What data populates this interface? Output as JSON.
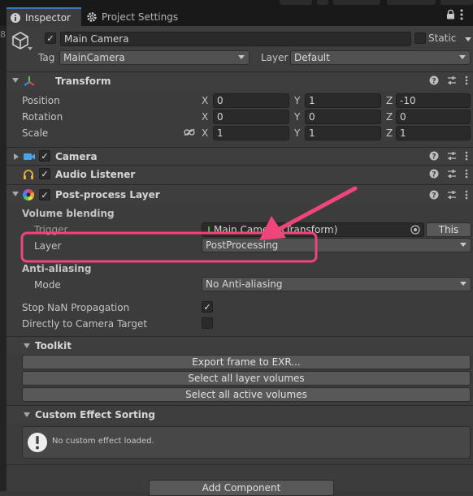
{
  "tabs": {
    "inspector": "Inspector",
    "project_settings": "Project Settings"
  },
  "gameobject": {
    "active": true,
    "name": "Main Camera",
    "static_label": "Static",
    "tag_label": "Tag",
    "tag_value": "MainCamera",
    "layer_label": "Layer",
    "layer_value": "Default"
  },
  "transform": {
    "title": "Transform",
    "position": {
      "label": "Position",
      "x": "0",
      "y": "1",
      "z": "-10"
    },
    "rotation": {
      "label": "Rotation",
      "x": "0",
      "y": "0",
      "z": "0"
    },
    "scale": {
      "label": "Scale",
      "x": "1",
      "y": "1",
      "z": "1"
    },
    "axis": {
      "x": "X",
      "y": "Y",
      "z": "Z"
    }
  },
  "components": {
    "camera": "Camera",
    "audio_listener": "Audio Listener",
    "post_process_layer": "Post-process Layer"
  },
  "volume_blending": {
    "section": "Volume blending",
    "trigger_label": "Trigger",
    "trigger_value": "Main Camera (Transform)",
    "this_button": "This",
    "layer_label": "Layer",
    "layer_value": "PostProcessing"
  },
  "anti_aliasing": {
    "section": "Anti-aliasing",
    "mode_label": "Mode",
    "mode_value": "No Anti-aliasing"
  },
  "options": {
    "stop_nan": "Stop NaN Propagation",
    "stop_nan_checked": true,
    "direct_to_target": "Directly to Camera Target",
    "direct_to_target_checked": false
  },
  "toolkit": {
    "title": "Toolkit",
    "buttons": [
      "Export frame to EXR...",
      "Select all layer volumes",
      "Select all active volumes"
    ]
  },
  "custom_effect_sorting": {
    "title": "Custom Effect Sorting",
    "message": "No custom effect loaded."
  },
  "add_component": "Add Component",
  "annotation_color": "#f0457a"
}
